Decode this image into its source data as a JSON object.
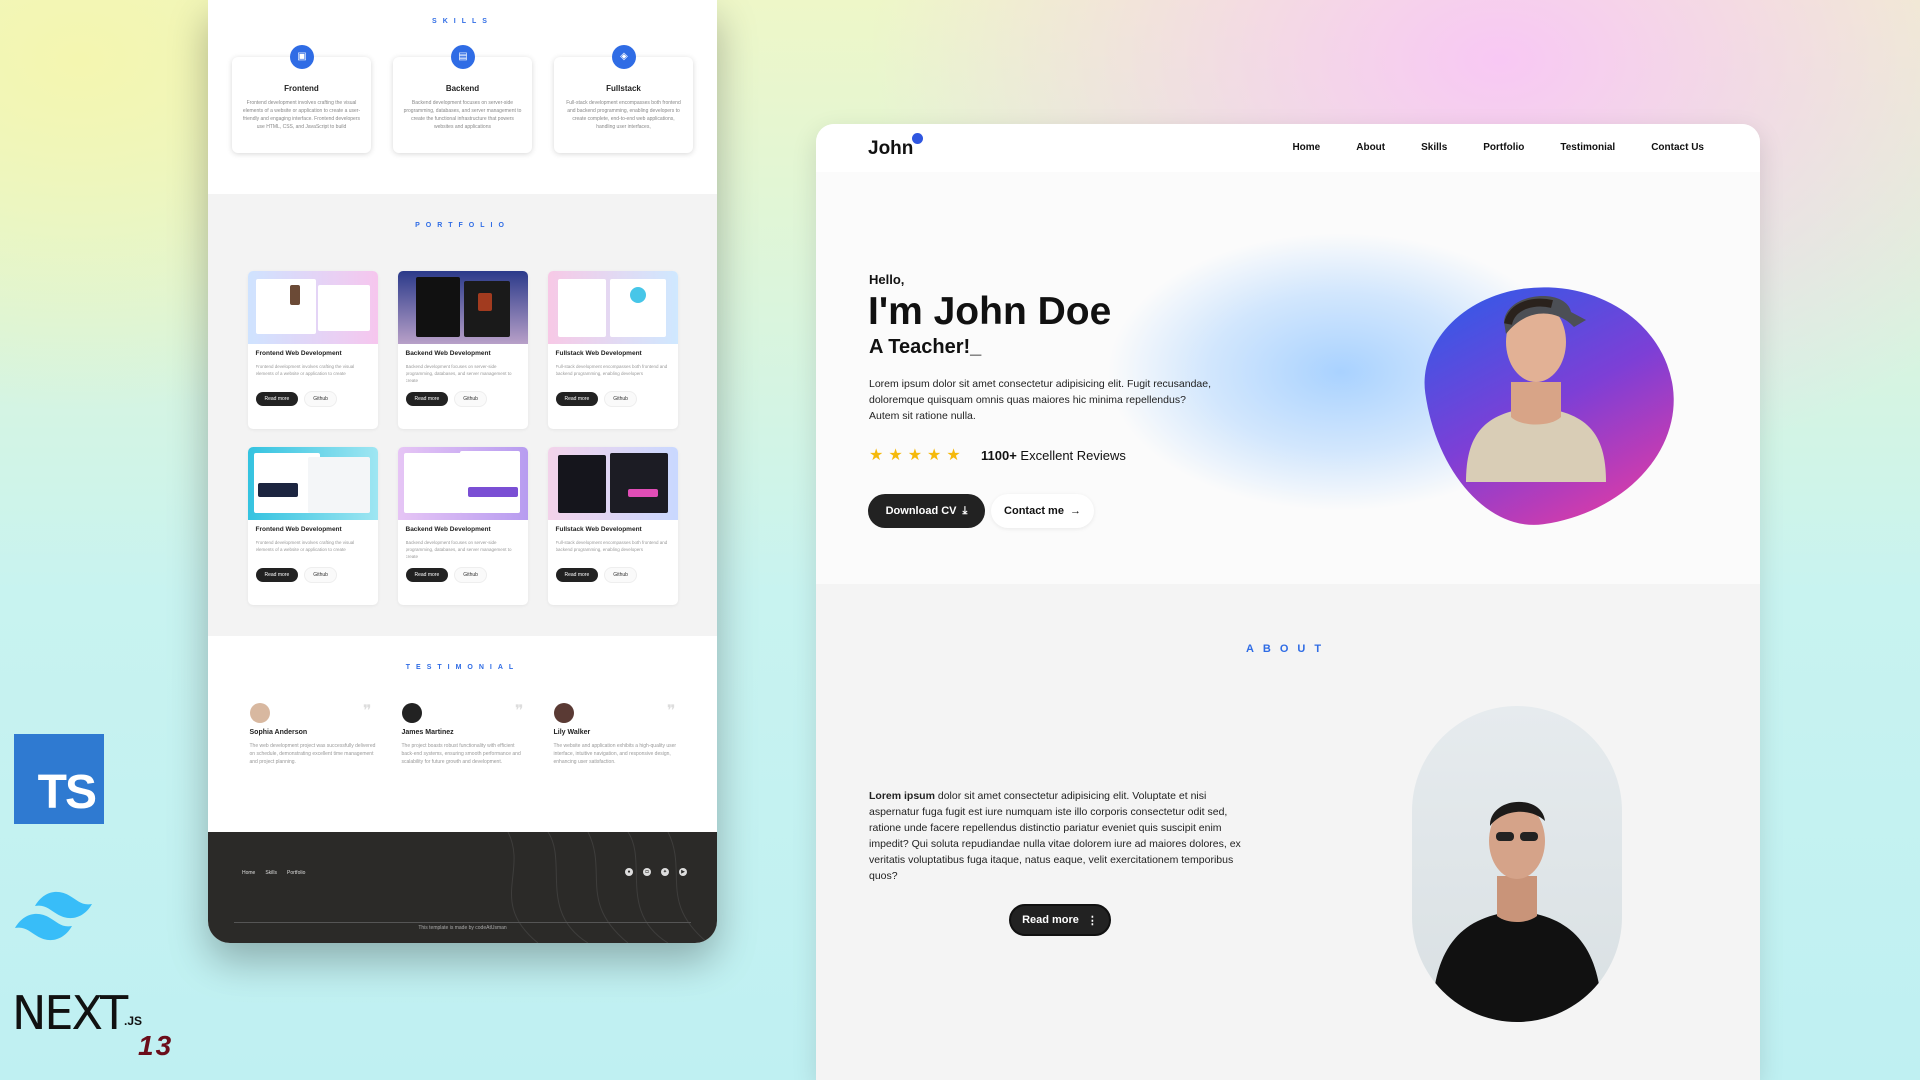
{
  "left": {
    "skills": {
      "title": "SKILLS",
      "items": [
        {
          "name": "Frontend",
          "icon": "monitor-icon",
          "desc": "Frontend development involves crafting the visual elements of a website or application to create a user-friendly and engaging interface. Frontend developers use HTML, CSS, and JavaScript to build"
        },
        {
          "name": "Backend",
          "icon": "server-icon",
          "desc": "Backend development focuses on server-side programming, databases, and server management to create the functional infrastructure that powers websites and applications"
        },
        {
          "name": "Fullstack",
          "icon": "layers-icon",
          "desc": "Full-stack development encompasses both frontend and backend programming, enabling developers to create complete, end-to-end web applications, handling user interfaces,"
        }
      ]
    },
    "portfolio": {
      "title": "PORTFOLIO",
      "items": [
        {
          "title": "Frontend Web Development",
          "desc": "Frontend development involves crafting the visual elements of a website or application to create",
          "read": "Read more",
          "git": "Github"
        },
        {
          "title": "Backend Web Development",
          "desc": "Backend development focuses on server-side programming, databases, and server management to create",
          "read": "Read more",
          "git": "Github"
        },
        {
          "title": "Fullstack Web Development",
          "desc": "Full-stack development encompasses both frontend and backend programming, enabling developers",
          "read": "Read more",
          "git": "Github"
        },
        {
          "title": "Frontend Web Development",
          "desc": "Frontend development involves crafting the visual elements of a website or application to create",
          "read": "Read more",
          "git": "Github"
        },
        {
          "title": "Backend Web Development",
          "desc": "Backend development focuses on server-side programming, databases, and server management to create",
          "read": "Read more",
          "git": "Github"
        },
        {
          "title": "Fullstack Web Development",
          "desc": "Full-stack development encompasses both frontend and backend programming, enabling developers",
          "read": "Read more",
          "git": "Github"
        }
      ]
    },
    "testimonial": {
      "title": "TESTIMONIAL",
      "items": [
        {
          "name": "Sophia Anderson",
          "text": "The web development project was successfully delivered on schedule, demonstrating excellent time management and project planning."
        },
        {
          "name": "James Martinez",
          "text": "The project boasts robust functionality with efficient back-end systems, ensuring smooth performance and scalability for future growth and development."
        },
        {
          "name": "Lily Walker",
          "text": "The website and application exhibits a high-quality user interface, intuitive navigation, and responsive design, enhancing user satisfaction."
        }
      ]
    },
    "footer": {
      "links": [
        "Home",
        "Skills",
        "Portfolio"
      ],
      "social": [
        "github-icon",
        "instagram-icon",
        "twitter-icon",
        "youtube-icon"
      ],
      "copyright": "This template is made by codeAtUsman"
    }
  },
  "right": {
    "logo": "John",
    "nav": [
      "Home",
      "About",
      "Skills",
      "Portfolio",
      "Testimonial",
      "Contact Us"
    ],
    "hero": {
      "hello": "Hello,",
      "name": "I'm John Doe",
      "role": "A Teacher!_",
      "intro": "Lorem ipsum dolor sit amet consectetur adipisicing elit. Fugit recusandae, doloremque quisquam omnis quas maiores hic minima repellendus? Autem sit ratione nulla.",
      "rating": 5,
      "reviews_count": "1100+",
      "reviews_label": "Excellent Reviews",
      "download_label": "Download CV",
      "contact_label": "Contact me"
    },
    "about": {
      "title": "ABOUT",
      "lead": "Lorem ipsum",
      "text": " dolor sit amet consectetur adipisicing elit. Voluptate et nisi aspernatur fuga fugit est iure numquam iste illo corporis consectetur odit sed, ratione unde facere repellendus distinctio pariatur eveniet quis suscipit enim impedit? Qui soluta repudiandae nulla vitae dolorem iure ad maiores dolores, ex veritatis voluptatibus fuga itaque, natus eaque, velit exercitationem temporibus quos?",
      "read_label": "Read more"
    }
  },
  "logos": {
    "ts": "TS",
    "next": "NEXT",
    "next_js": ".JS",
    "next_version": "13"
  },
  "colors": {
    "accent": "#2f6ce5",
    "dark": "#222222",
    "star": "#f5b90b"
  }
}
